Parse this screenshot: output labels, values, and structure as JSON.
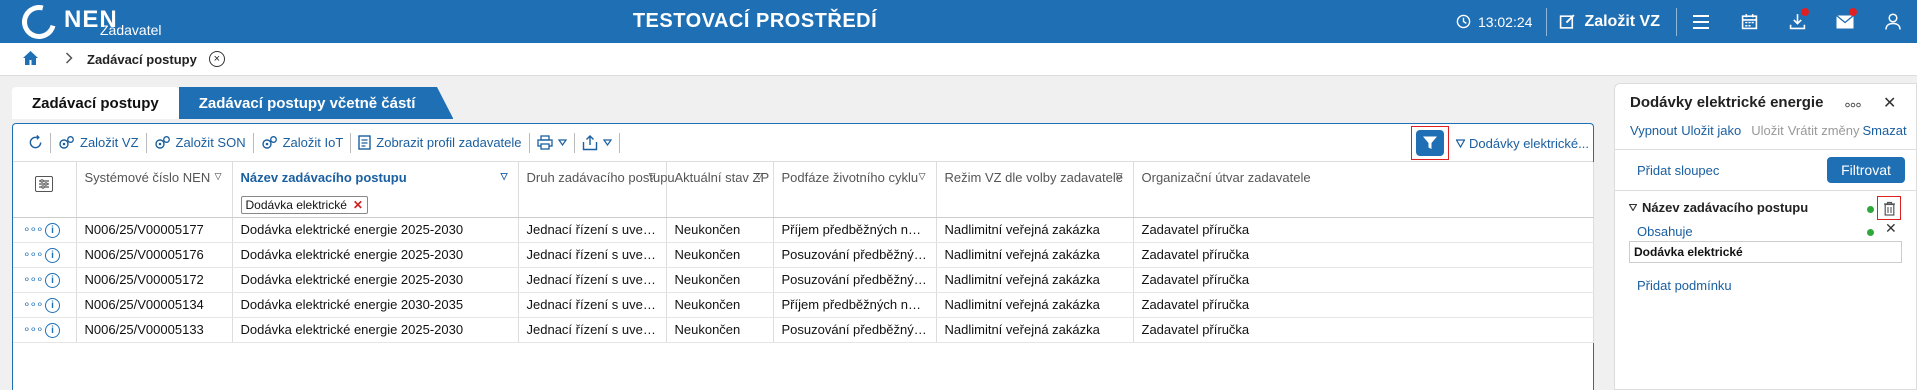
{
  "header": {
    "logo_text": "NEN",
    "logo_sub": "Zadavatel",
    "environment_title": "TESTOVACÍ PROSTŘEDÍ",
    "clock": "13:02:24",
    "create_vz_label": "Založit VZ",
    "icons": [
      "clock-icon",
      "edit-icon",
      "menu-icon",
      "calendar-icon",
      "download-icon",
      "mail-icon",
      "user-icon"
    ],
    "accent_color": "#1f6fb5",
    "notification_color": "#e02020"
  },
  "breadcrumb": {
    "home_icon": "home-icon",
    "current": "Zadávací postupy"
  },
  "tabs": [
    {
      "label": "Zadávací postupy",
      "active": true
    },
    {
      "label": "Zadávací postupy včetně částí",
      "active": false
    }
  ],
  "toolbar": {
    "create_vz": "Založit VZ",
    "create_son": "Založit SON",
    "create_iot": "Založit IoT",
    "show_profile": "Zobrazit profil zadavatele",
    "filter_summary": "Dodávky elektrické..."
  },
  "table": {
    "columns": [
      "Systémové číslo NEN",
      "Název zadávacího postupu",
      "Druh zadávacího postupu",
      "Aktuální stav ZP",
      "Podfáze životního cyklu",
      "Režim VZ dle volby zadavatele",
      "Organizační útvar zadavatele"
    ],
    "filter_chip": "Dodávka elektrické",
    "rows": [
      [
        "N006/25/V00005177",
        "Dodávka elektrické energie 2025-2030",
        "Jednací řízení s uveřejnění...",
        "Neukončen",
        "Příjem předběžných nabídek",
        "Nadlimitní veřejná zakázka",
        "Zadavatel příručka"
      ],
      [
        "N006/25/V00005176",
        "Dodávka elektrické energie 2025-2030",
        "Jednací řízení s uveřejnění...",
        "Neukončen",
        "Posuzování předběžných nabí...",
        "Nadlimitní veřejná zakázka",
        "Zadavatel příručka"
      ],
      [
        "N006/25/V00005172",
        "Dodávka elektrické energie 2025-2030",
        "Jednací řízení s uveřejnění...",
        "Neukončen",
        "Posuzování předběžných nabí...",
        "Nadlimitní veřejná zakázka",
        "Zadavatel příručka"
      ],
      [
        "N006/25/V00005134",
        "Dodávka elektrické energie 2030-2035",
        "Jednací řízení s uveřejnění...",
        "Neukončen",
        "Příjem předběžných nabídek",
        "Nadlimitní veřejná zakázka",
        "Zadavatel příručka"
      ],
      [
        "N006/25/V00005133",
        "Dodávka elektrické energie 2025-2030",
        "Jednací řízení s uveřejnění...",
        "Neukončen",
        "Posuzování předběžných nabí...",
        "Nadlimitní veřejná zakázka",
        "Zadavatel příručka"
      ]
    ]
  },
  "side_panel": {
    "title": "Dodávky elektrické energie",
    "actions": {
      "disable": "Vypnout",
      "save_as": "Uložit jako",
      "save": "Uložit",
      "undo": "Vrátit změny",
      "delete": "Smazat"
    },
    "add_column": "Přidat sloupec",
    "filter_button": "Filtrovat",
    "condition": {
      "field": "Název zadávacího postupu",
      "operator": "Obsahuje",
      "value": "Dodávka elektrické"
    },
    "add_condition": "Přidat podmínku"
  }
}
